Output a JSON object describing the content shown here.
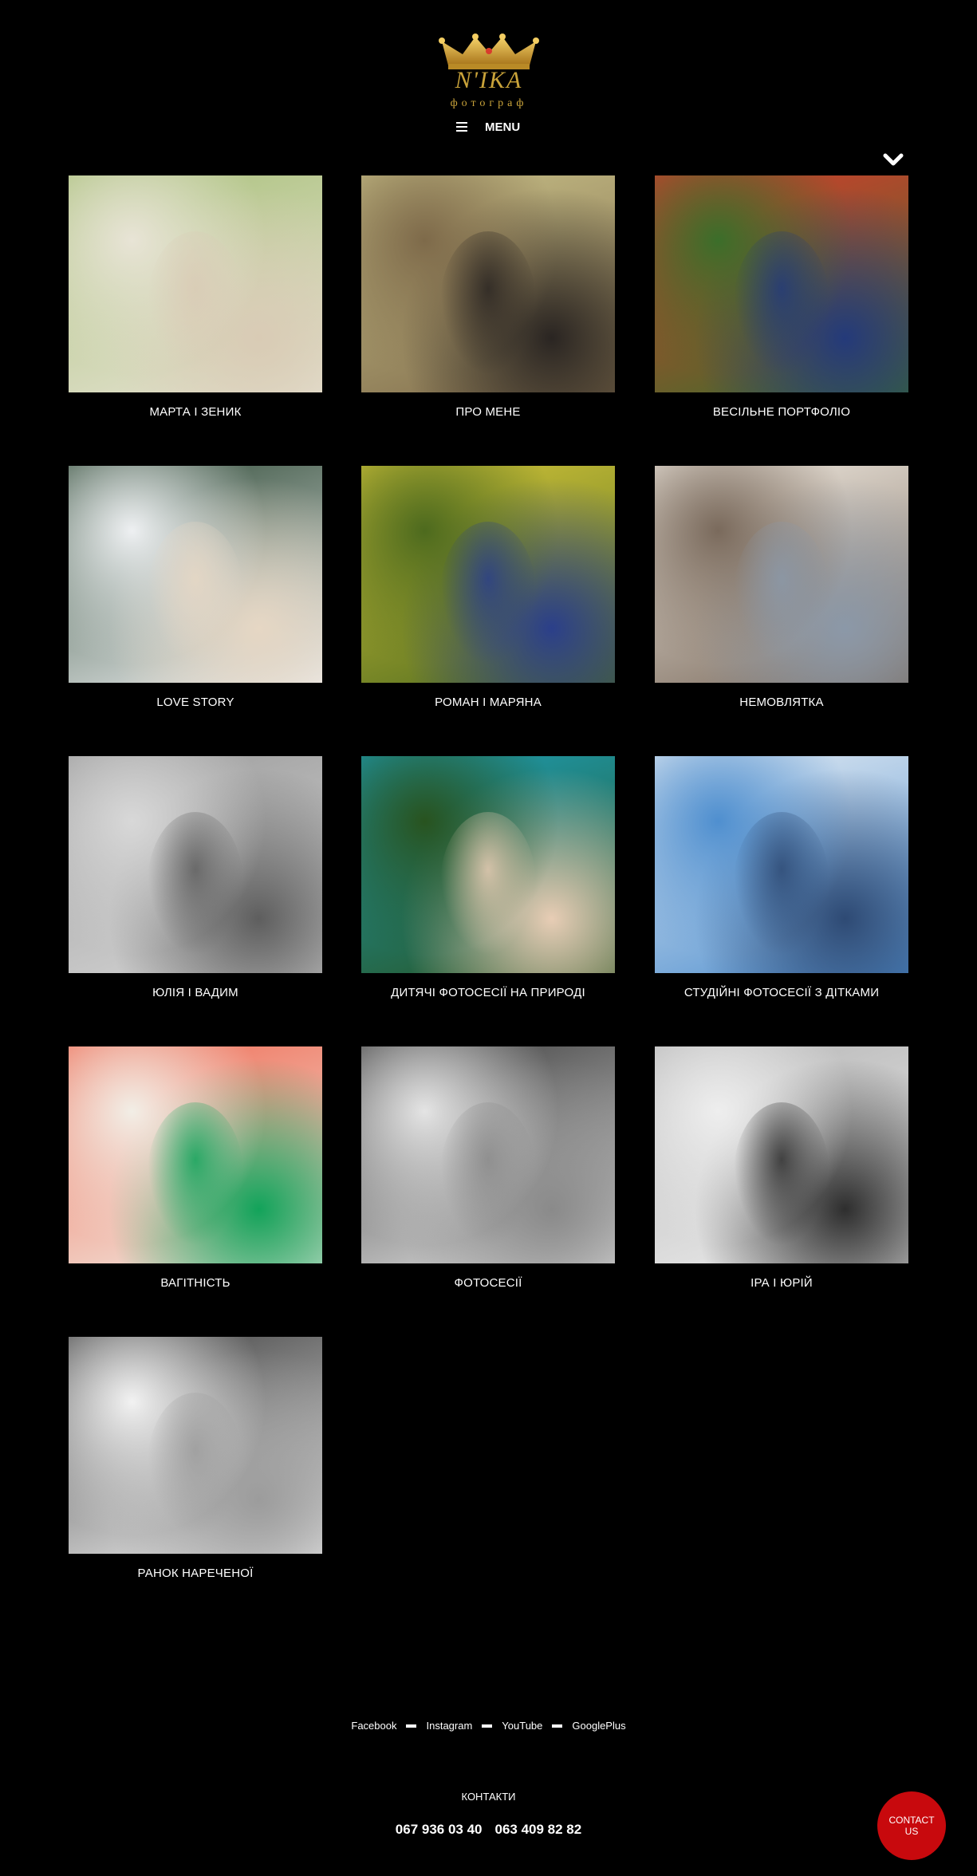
{
  "header": {
    "logo_name": "N'IKA",
    "logo_sub": "фотограф",
    "menu_label": "MENU",
    "icons": [
      "crown-icon",
      "hamburger-icon",
      "chevron-down-icon"
    ],
    "accent_color": "#c9a33a"
  },
  "gallery": [
    {
      "caption": "МАРТА І ЗЕНИК",
      "tone": "color",
      "colors": [
        "#e8e4d6",
        "#a9c07a",
        "#d9cbb5"
      ]
    },
    {
      "caption": "ПРО МЕНЕ",
      "tone": "color",
      "colors": [
        "#7e6a4a",
        "#c9c189",
        "#2a2522"
      ]
    },
    {
      "caption": "ВЕСІЛЬНЕ ПОРТФОЛІО",
      "tone": "color",
      "colors": [
        "#3b6e2a",
        "#d83c2d",
        "#243a7a"
      ]
    },
    {
      "caption": "LOVE STORY",
      "tone": "color",
      "colors": [
        "#eef0f2",
        "#2f4a36",
        "#e6d7c4"
      ]
    },
    {
      "caption": "РОМАН І МАРЯНА",
      "tone": "color",
      "colors": [
        "#4d6a1e",
        "#d7c73a",
        "#2b3f8a"
      ]
    },
    {
      "caption": "НЕМОВЛЯТКА",
      "tone": "color",
      "colors": [
        "#7a6a5c",
        "#f3ede4",
        "#8b98a8"
      ]
    },
    {
      "caption": "ЮЛІЯ І ВАДИМ",
      "tone": "mono",
      "colors": [
        "#d8d8d8",
        "#9a9a9a",
        "#5e5e5e"
      ]
    },
    {
      "caption": "ДИТЯЧІ ФОТОСЕСІЇ НА ПРИРОДІ",
      "tone": "color",
      "colors": [
        "#28531f",
        "#1d9fb8",
        "#e8cdb5"
      ]
    },
    {
      "caption": "СТУДІЙНІ ФОТОСЕСІЇ З ДІТКАМИ",
      "tone": "color",
      "colors": [
        "#4f8fcf",
        "#e8eef4",
        "#2e4a74"
      ]
    },
    {
      "caption": "ВАГІТНІСТЬ",
      "tone": "color",
      "colors": [
        "#f2eee6",
        "#ef6a52",
        "#12a35a"
      ]
    },
    {
      "caption": "ФОТОСЕСІЇ",
      "tone": "mono",
      "colors": [
        "#e4e4e4",
        "#3a3a3a",
        "#8a8a8a"
      ]
    },
    {
      "caption": "ІРА І ЮРІЙ",
      "tone": "mono",
      "colors": [
        "#eeeeee",
        "#b5b5b5",
        "#2e2e2e"
      ]
    },
    {
      "caption": "РАНОК НАРЕЧЕНОЇ",
      "tone": "mono",
      "colors": [
        "#f2f2f2",
        "#3c3c3c",
        "#9c9c9c"
      ]
    }
  ],
  "footer": {
    "social": [
      "Facebook",
      "Instagram",
      "YouTube",
      "GooglePlus"
    ],
    "contacts_title": "КОНТАКТИ",
    "phones": [
      "067 936 03 40",
      "063 409 82 82"
    ],
    "contact_button": "CONTACT US",
    "contact_button_color": "#c8090d"
  }
}
